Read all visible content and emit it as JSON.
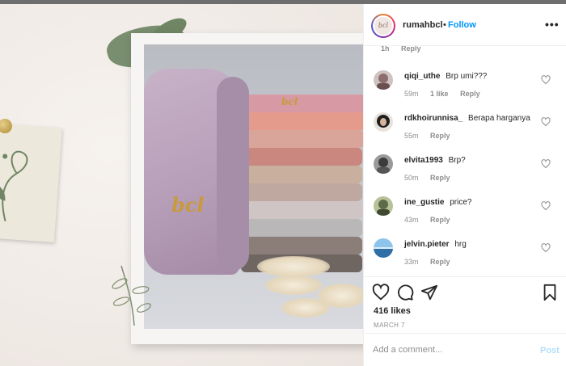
{
  "post": {
    "username": "rumahbcl",
    "separator": "•",
    "follow_label": "Follow",
    "avatar_text": "bcl",
    "more_icon": "more-horizontal-icon"
  },
  "image": {
    "logo_text": "bcl",
    "description_colors": {
      "background": "#f1ece8",
      "leaf_paint": "#6f8563"
    }
  },
  "comments": {
    "cut_off": {
      "time": "1h",
      "reply": "Reply"
    },
    "items": [
      {
        "username": "qiqi_uthe",
        "text": "Brp umi???",
        "time": "59m",
        "likes": "1 like",
        "reply": "Reply",
        "avatar_color": "#8d6e6e"
      },
      {
        "username": "rdkhoirunnisa_",
        "text": "Berapa harganya",
        "time": "55m",
        "likes": "",
        "reply": "Reply",
        "avatar_color": "#2a2a2a"
      },
      {
        "username": "elvita1993",
        "text": "Brp?",
        "time": "50m",
        "likes": "",
        "reply": "Reply",
        "avatar_color": "#5a5a5a"
      },
      {
        "username": "ine_gustie",
        "text": "price?",
        "time": "43m",
        "likes": "",
        "reply": "Reply",
        "avatar_color": "#6c7b55"
      },
      {
        "username": "jelvin.pieter",
        "text": "hrg",
        "time": "33m",
        "likes": "",
        "reply": "Reply",
        "avatar_color": "#4b8fc7"
      }
    ]
  },
  "actions": {
    "likes": "416 likes",
    "date": "MARCH 7"
  },
  "comment_box": {
    "placeholder": "Add a comment...",
    "post_label": "Post"
  },
  "colors": {
    "accent": "#0095f6",
    "muted": "#8e8e8e",
    "post_disabled": "#b2dffc"
  }
}
